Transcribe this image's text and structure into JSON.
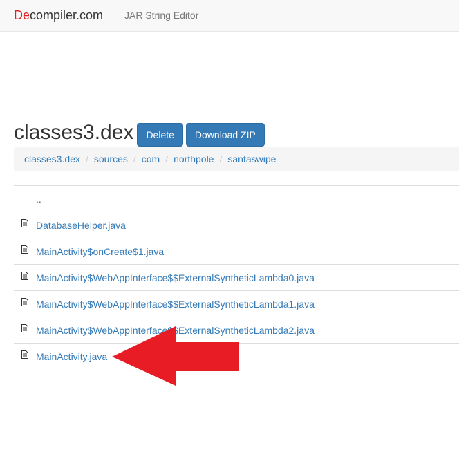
{
  "navbar": {
    "brand_accent": "De",
    "brand_rest": "compiler.com",
    "link": "JAR String Editor"
  },
  "page": {
    "title": "classes3.dex",
    "delete_label": "Delete",
    "download_label": "Download ZIP"
  },
  "breadcrumb": {
    "items": [
      "classes3.dex",
      "sources",
      "com",
      "northpole",
      "santaswipe"
    ],
    "separator": "/"
  },
  "files": {
    "parent": "..",
    "items": [
      "DatabaseHelper.java",
      "MainActivity$onCreate$1.java",
      "MainActivity$WebAppInterface$$ExternalSyntheticLambda0.java",
      "MainActivity$WebAppInterface$$ExternalSyntheticLambda1.java",
      "MainActivity$WebAppInterface$$ExternalSyntheticLambda2.java",
      "MainActivity.java"
    ],
    "icon": "file-icon"
  },
  "annotation": {
    "icon": "red-arrow-left-icon",
    "color": "#e81c24"
  },
  "colors": {
    "link": "#337ab7",
    "button": "#337ab7",
    "brand_accent": "#e0211f"
  }
}
